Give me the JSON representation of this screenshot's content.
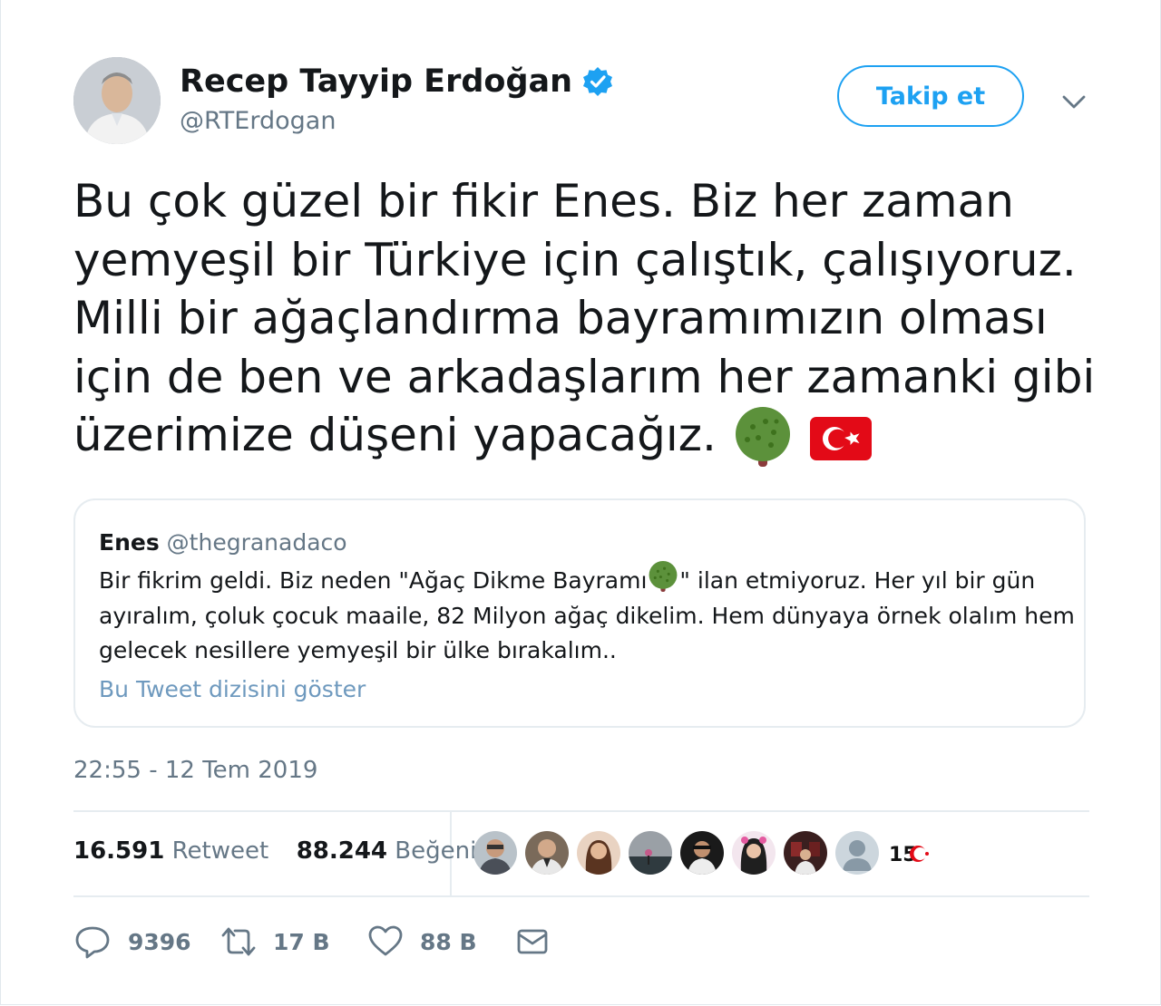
{
  "author": {
    "name": "Recep Tayyip Erdoğan",
    "handle": "@RTErdogan"
  },
  "follow_label": "Takip et",
  "tweet": {
    "line1": "Bu çok güzel bir fikir Enes. Biz her zaman",
    "line2": "yemyeşil bir Türkiye için çalıştık, çalışıyoruz.",
    "line3": "Milli bir ağaçlandırma bayramımızın olması",
    "line4": "için de ben ve arkadaşlarım her zamanki gibi",
    "line5": "üzerimize düşeni yapacağız.",
    "emojis": [
      "deciduous-tree-emoji",
      "turkey-flag-emoji"
    ]
  },
  "quoted": {
    "name": "Enes",
    "handle": "@thegranadaco",
    "text_part1": "Bir fikrim geldi. Biz neden \"Ağaç Dikme Bayramı",
    "text_part2": "\" ilan etmiyoruz. Her yıl bir gün ayıralım, çoluk çocuk maaile, 82 Milyon ağaç dikelim. Hem dünyaya örnek olalım hem gelecek nesillere yemyeşil bir ülke bırakalım..",
    "show_thread": "Bu Tweet dizisini göster"
  },
  "timestamp": "22:55 - 12 Tem 2019",
  "stats": {
    "retweets": "16.591",
    "retweets_label": "Retweet",
    "likes": "88.244",
    "likes_label": "Beğeni"
  },
  "actions": {
    "replies": "9396",
    "retweets": "17 B",
    "likes": "88 B"
  },
  "colors": {
    "accent": "#1da1f2",
    "muted": "#657786",
    "border": "#e6ecf0"
  }
}
